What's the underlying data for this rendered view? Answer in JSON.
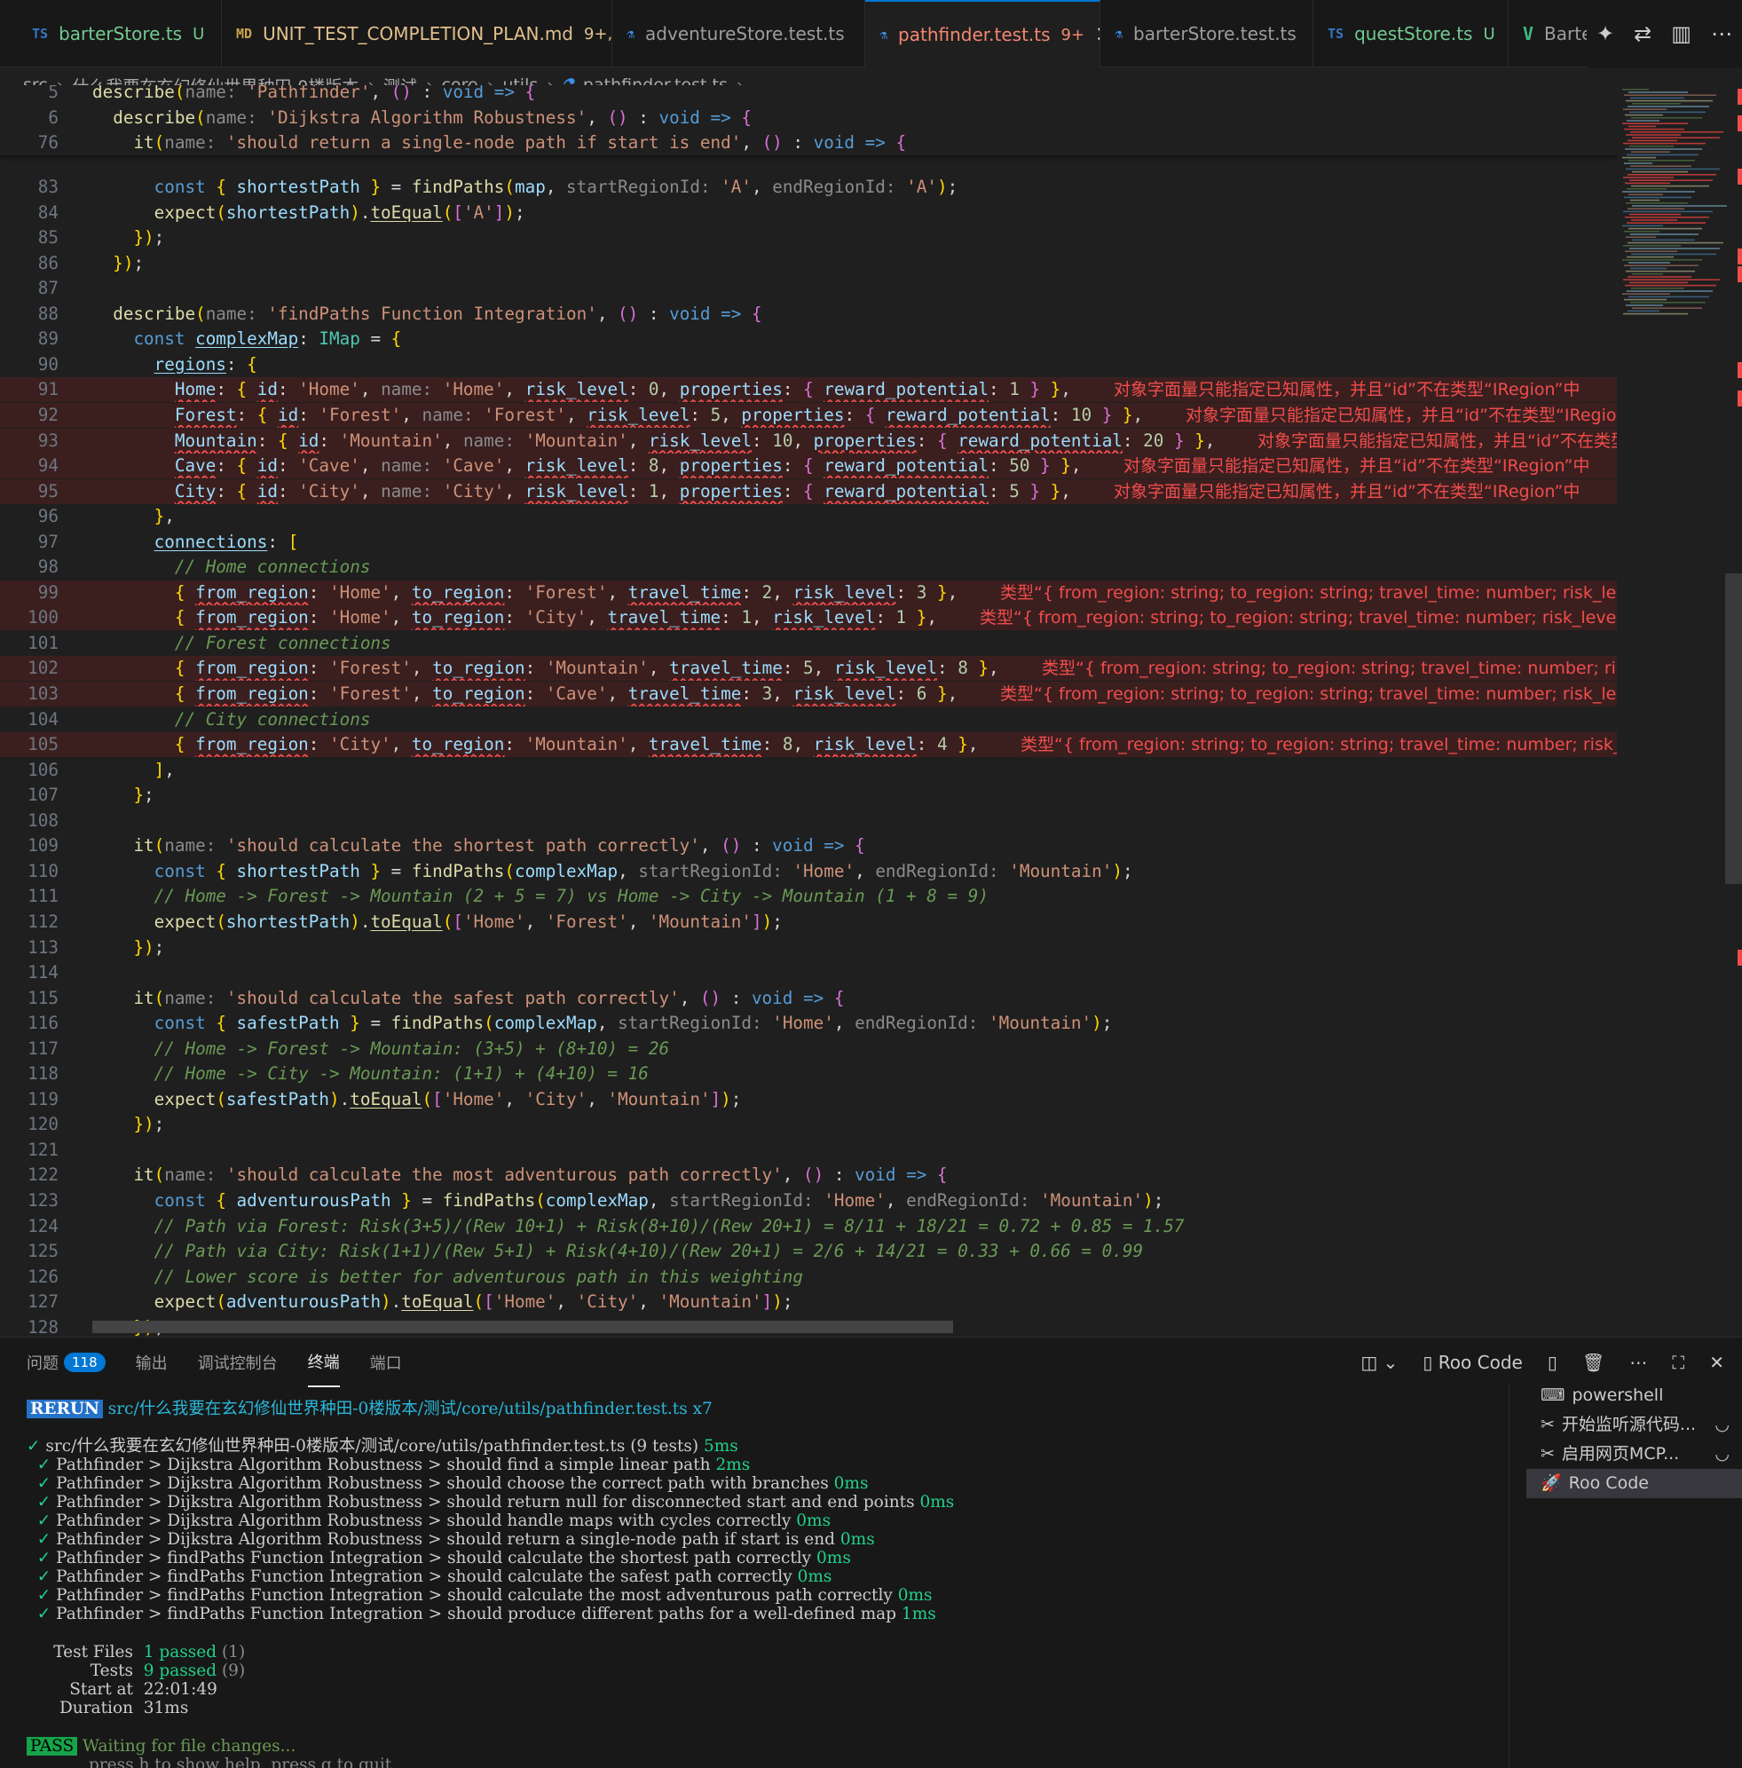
{
  "tabs": [
    {
      "icon": "TS",
      "icon_kind": "ts",
      "name": "barterStore.ts",
      "status": "U",
      "status_kind": "untracked"
    },
    {
      "icon": "MD",
      "icon_kind": "md",
      "name": "UNIT_TEST_COMPLETION_PLAN.md",
      "status": "9+, U",
      "status_kind": "modified"
    },
    {
      "icon": "⚗",
      "icon_kind": "flask",
      "name": "adventureStore.test.ts",
      "status": "",
      "status_kind": ""
    },
    {
      "icon": "⚗",
      "icon_kind": "flask",
      "name": "pathfinder.test.ts",
      "status": "9+",
      "status_kind": "error",
      "active": true,
      "close": "✕"
    },
    {
      "icon": "⚗",
      "icon_kind": "flask",
      "name": "barterStore.test.ts",
      "status": "",
      "status_kind": ""
    },
    {
      "icon": "TS",
      "icon_kind": "ts",
      "name": "questStore.ts",
      "status": "U",
      "status_kind": "untracked"
    },
    {
      "icon": "V",
      "icon_kind": "vue",
      "name": "Barte",
      "status": "",
      "status_kind": ""
    }
  ],
  "tab_actions": [
    "sparkle-icon",
    "compare-icon",
    "split-editor-icon",
    "more-icon"
  ],
  "breadcrumb": [
    "src",
    "什么我要在玄幻修仙世界种田-0楼版本",
    "测试",
    "core",
    "utils",
    "pathfinder.test.ts",
    "..."
  ],
  "sticky": [
    {
      "n": "5",
      "t": "describe(name: 'Pathfinder', () : void => {"
    },
    {
      "n": "6",
      "t": "  describe(name: 'Dijkstra Algorithm Robustness', () : void => {"
    },
    {
      "n": "76",
      "t": "    it(name: 'should return a single-node path if start is end', () : void => {"
    }
  ],
  "lines": [
    {
      "n": "83",
      "t": "      const { shortestPath } = findPaths(map, startRegionId: 'A', endRegionId: 'A');"
    },
    {
      "n": "84",
      "t": "      expect(shortestPath).toEqual(['A']);"
    },
    {
      "n": "85",
      "t": "    });"
    },
    {
      "n": "86",
      "t": "  });"
    },
    {
      "n": "87",
      "t": ""
    },
    {
      "n": "88",
      "t": "  describe(name: 'findPaths Function Integration', () : void => {"
    },
    {
      "n": "89",
      "t": "    const complexMap: IMap = {"
    },
    {
      "n": "90",
      "t": "      regions: {"
    },
    {
      "n": "91",
      "t": "        Home: { id: 'Home', name: 'Home', risk_level: 0, properties: { reward_potential: 1 } },",
      "err": true,
      "diag": "对象字面量只能指定已知属性，并且“id”不在类型“IRegion”中"
    },
    {
      "n": "92",
      "t": "        Forest: { id: 'Forest', name: 'Forest', risk_level: 5, properties: { reward_potential: 10 } },",
      "err": true,
      "diag": "对象字面量只能指定已知属性，并且“id”不在类型“IRegion”中"
    },
    {
      "n": "93",
      "t": "        Mountain: { id: 'Mountain', name: 'Mountain', risk_level: 10, properties: { reward_potential: 20 } },",
      "err": true,
      "diag": "对象字面量只能指定已知属性，并且“id”不在类型“IRegion”中"
    },
    {
      "n": "94",
      "t": "        Cave: { id: 'Cave', name: 'Cave', risk_level: 8, properties: { reward_potential: 50 } },",
      "err": true,
      "diag": "对象字面量只能指定已知属性，并且“id”不在类型“IRegion”中"
    },
    {
      "n": "95",
      "t": "        City: { id: 'City', name: 'City', risk_level: 1, properties: { reward_potential: 5 } },",
      "err": true,
      "diag": "对象字面量只能指定已知属性，并且“id”不在类型“IRegion”中"
    },
    {
      "n": "96",
      "t": "      },"
    },
    {
      "n": "97",
      "t": "      connections: ["
    },
    {
      "n": "98",
      "t": "        // Home connections",
      "c": true
    },
    {
      "n": "99",
      "t": "        { from_region: 'Home', to_region: 'Forest', travel_time: 2, risk_level: 3 },",
      "err": true,
      "diag": "类型“{ from_region: string; to_region: string; travel_time: number; risk_level: number; }”"
    },
    {
      "n": "100",
      "t": "        { from_region: 'Home', to_region: 'City', travel_time: 1, risk_level: 1 },",
      "err": true,
      "diag": "类型“{ from_region: string; to_region: string; travel_time: number; risk_level: number; }”"
    },
    {
      "n": "101",
      "t": "        // Forest connections",
      "c": true
    },
    {
      "n": "102",
      "t": "        { from_region: 'Forest', to_region: 'Mountain', travel_time: 5, risk_level: 8 },",
      "err": true,
      "diag": "类型“{ from_region: string; to_region: string; travel_time: number; risk_level: number; }”"
    },
    {
      "n": "103",
      "t": "        { from_region: 'Forest', to_region: 'Cave', travel_time: 3, risk_level: 6 },",
      "err": true,
      "diag": "类型“{ from_region: string; to_region: string; travel_time: number; risk_level: number; }”"
    },
    {
      "n": "104",
      "t": "        // City connections",
      "c": true
    },
    {
      "n": "105",
      "t": "        { from_region: 'City', to_region: 'Mountain', travel_time: 8, risk_level: 4 },",
      "err": true,
      "diag": "类型“{ from_region: string; to_region: string; travel_time: number; risk_level: number; }”"
    },
    {
      "n": "106",
      "t": "      ],"
    },
    {
      "n": "107",
      "t": "    };"
    },
    {
      "n": "108",
      "t": ""
    },
    {
      "n": "109",
      "t": "    it(name: 'should calculate the shortest path correctly', () : void => {"
    },
    {
      "n": "110",
      "t": "      const { shortestPath } = findPaths(complexMap, startRegionId: 'Home', endRegionId: 'Mountain');"
    },
    {
      "n": "111",
      "t": "      // Home -> Forest -> Mountain (2 + 5 = 7) vs Home -> City -> Mountain (1 + 8 = 9)",
      "c": true
    },
    {
      "n": "112",
      "t": "      expect(shortestPath).toEqual(['Home', 'Forest', 'Mountain']);"
    },
    {
      "n": "113",
      "t": "    });"
    },
    {
      "n": "114",
      "t": ""
    },
    {
      "n": "115",
      "t": "    it(name: 'should calculate the safest path correctly', () : void => {"
    },
    {
      "n": "116",
      "t": "      const { safestPath } = findPaths(complexMap, startRegionId: 'Home', endRegionId: 'Mountain');"
    },
    {
      "n": "117",
      "t": "      // Home -> Forest -> Mountain: (3+5) + (8+10) = 26",
      "c": true
    },
    {
      "n": "118",
      "t": "      // Home -> City -> Mountain: (1+1) + (4+10) = 16",
      "c": true
    },
    {
      "n": "119",
      "t": "      expect(safestPath).toEqual(['Home', 'City', 'Mountain']);"
    },
    {
      "n": "120",
      "t": "    });"
    },
    {
      "n": "121",
      "t": ""
    },
    {
      "n": "122",
      "t": "    it(name: 'should calculate the most adventurous path correctly', () : void => {"
    },
    {
      "n": "123",
      "t": "      const { adventurousPath } = findPaths(complexMap, startRegionId: 'Home', endRegionId: 'Mountain');"
    },
    {
      "n": "124",
      "t": "      // Path via Forest: Risk(3+5)/(Rew 10+1) + Risk(8+10)/(Rew 20+1) = 8/11 + 18/21 = 0.72 + 0.85 = 1.57",
      "c": true
    },
    {
      "n": "125",
      "t": "      // Path via City: Risk(1+1)/(Rew 5+1) + Risk(4+10)/(Rew 20+1) = 2/6 + 14/21 = 0.33 + 0.66 = 0.99",
      "c": true
    },
    {
      "n": "126",
      "t": "      // Lower score is better for adventurous path in this weighting",
      "c": true
    },
    {
      "n": "127",
      "t": "      expect(adventurousPath).toEqual(['Home', 'City', 'Mountain']);"
    },
    {
      "n": "128",
      "t": "    });"
    }
  ],
  "panel": {
    "tabs": [
      {
        "label": "问题",
        "badge": "118"
      },
      {
        "label": "输出"
      },
      {
        "label": "调试控制台"
      },
      {
        "label": "终端",
        "active": true
      },
      {
        "label": "端口"
      }
    ],
    "roo_label": "Roo Code"
  },
  "terminal": {
    "rerun_badge": "RERUN",
    "rerun_path": "src/什么我要在玄幻修仙世界种田-0楼版本/测试/core/utils/pathfinder.test.ts x7",
    "file_line": "src/什么我要在玄幻修仙世界种田-0楼版本/测试/core/utils/pathfinder.test.ts (9 tests)",
    "file_time": "5ms",
    "tests": [
      {
        "path": "Pathfinder > Dijkstra Algorithm Robustness > should find a simple linear path",
        "time": "2ms"
      },
      {
        "path": "Pathfinder > Dijkstra Algorithm Robustness > should choose the correct path with branches",
        "time": "0ms"
      },
      {
        "path": "Pathfinder > Dijkstra Algorithm Robustness > should return null for disconnected start and end points",
        "time": "0ms"
      },
      {
        "path": "Pathfinder > Dijkstra Algorithm Robustness > should handle maps with cycles correctly",
        "time": "0ms"
      },
      {
        "path": "Pathfinder > Dijkstra Algorithm Robustness > should return a single-node path if start is end",
        "time": "0ms"
      },
      {
        "path": "Pathfinder > findPaths Function Integration > should calculate the shortest path correctly",
        "time": "0ms"
      },
      {
        "path": "Pathfinder > findPaths Function Integration > should calculate the safest path correctly",
        "time": "0ms"
      },
      {
        "path": "Pathfinder > findPaths Function Integration > should calculate the most adventurous path correctly",
        "time": "0ms"
      },
      {
        "path": "Pathfinder > findPaths Function Integration > should produce different paths for a well-defined map",
        "time": "1ms"
      }
    ],
    "summary": {
      "files_label": "Test Files",
      "files_value": "1 passed",
      "files_count": "(1)",
      "tests_label": "Tests",
      "tests_value": "9 passed",
      "tests_count": "(9)",
      "start_label": "Start at",
      "start_value": "22:01:49",
      "duration_label": "Duration",
      "duration_value": "31ms"
    },
    "pass_badge": "PASS",
    "waiting": "Waiting for file changes...",
    "help": "press h to show help, press q to quit"
  },
  "term_list": [
    {
      "icon": "terminal-icon",
      "glyph": "⌨",
      "label": "powershell"
    },
    {
      "icon": "tools-icon",
      "glyph": "✂",
      "label": "开始监听源代码...",
      "spin": true
    },
    {
      "icon": "tools-icon",
      "glyph": "✂",
      "label": "启用网页MCP...",
      "spin": true
    },
    {
      "icon": "rocket-icon",
      "glyph": "🚀",
      "label": "Roo Code",
      "selected": true
    }
  ]
}
